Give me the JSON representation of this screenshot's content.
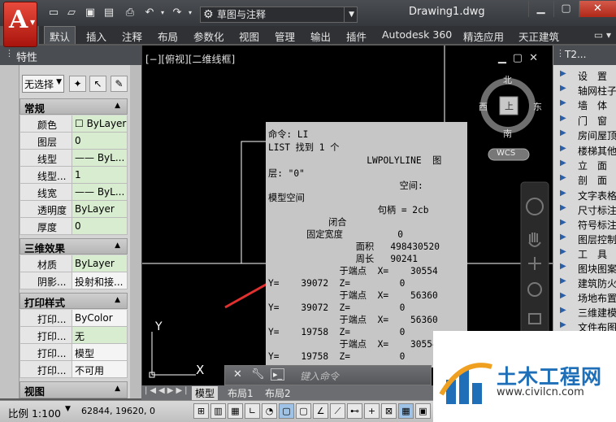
{
  "window": {
    "document_title": "Drawing1.dwg",
    "workspace": "草图与注释"
  },
  "ribbon": {
    "tabs": [
      "默认",
      "插入",
      "注释",
      "布局",
      "参数化",
      "视图",
      "管理",
      "输出",
      "插件",
      "Autodesk 360",
      "精选应用",
      "天正建筑"
    ],
    "extra": "▭ ▾"
  },
  "viewport": {
    "label": "[−][俯视][二维线框]",
    "compass": {
      "north": "北",
      "south": "南",
      "east": "东",
      "west": "西",
      "top": "上"
    },
    "wcs": "WCS",
    "ucs_y": "Y",
    "ucs_x": "X"
  },
  "command_output": {
    "lines": [
      "命令: LI",
      "LIST 找到 1 个",
      "                  LWPOLYLINE  图",
      "层: \"0\"",
      "                        空间:",
      "模型空间",
      "                    句柄 = 2cb",
      "           闭合",
      "       固定宽度          0",
      "                面积   498430520",
      "                周长   90241",
      "             于端点  X=    30554",
      "Y=    39072  Z=         0",
      "             于端点  X=    56360",
      "Y=    39072  Z=         0",
      "             于端点  X=    56360",
      "Y=    19758  Z=         0",
      "             于端点  X=    30554",
      "Y=    19758  Z=         0"
    ]
  },
  "command_input": {
    "placeholder": "键入命令"
  },
  "properties_palette": {
    "title": "特性",
    "selection": "无选择",
    "sections": [
      {
        "title": "常规",
        "rows": [
          {
            "k": "颜色",
            "v": "☐ ByLayer"
          },
          {
            "k": "图层",
            "v": "0"
          },
          {
            "k": "线型",
            "v": "—— ByL..."
          },
          {
            "k": "线型...",
            "v": "1"
          },
          {
            "k": "线宽",
            "v": "—— ByL..."
          },
          {
            "k": "透明度",
            "v": "ByLayer"
          },
          {
            "k": "厚度",
            "v": "0"
          }
        ]
      },
      {
        "title": "三维效果",
        "rows": [
          {
            "k": "材质",
            "v": "ByLayer"
          },
          {
            "k": "阴影...",
            "v": "投射和接..."
          }
        ]
      },
      {
        "title": "打印样式",
        "rows": [
          {
            "k": "打印...",
            "v": "ByColor"
          },
          {
            "k": "打印...",
            "v": "无"
          },
          {
            "k": "打印...",
            "v": "模型"
          },
          {
            "k": "打印...",
            "v": "不可用"
          }
        ]
      },
      {
        "title": "视图",
        "rows": []
      }
    ]
  },
  "tool_palette": {
    "title": "T2...",
    "items": [
      "设　置",
      "轴网柱子",
      "墙　体",
      "门　窗",
      "房间屋顶",
      "楼梯其他",
      "立　面",
      "剖　面",
      "文字表格",
      "尺寸标注",
      "符号标注",
      "图层控制",
      "工　具",
      "图块图案",
      "建筑防火",
      "场地布置",
      "三维建模",
      "文件布图"
    ]
  },
  "layout_tabs": [
    "模型",
    "布局1",
    "布局2"
  ],
  "status": {
    "scale": "比例 1:100",
    "coords": "62844, 19620, 0"
  },
  "watermark": {
    "main": "土木工程网",
    "url": "www.civilcn.com"
  }
}
